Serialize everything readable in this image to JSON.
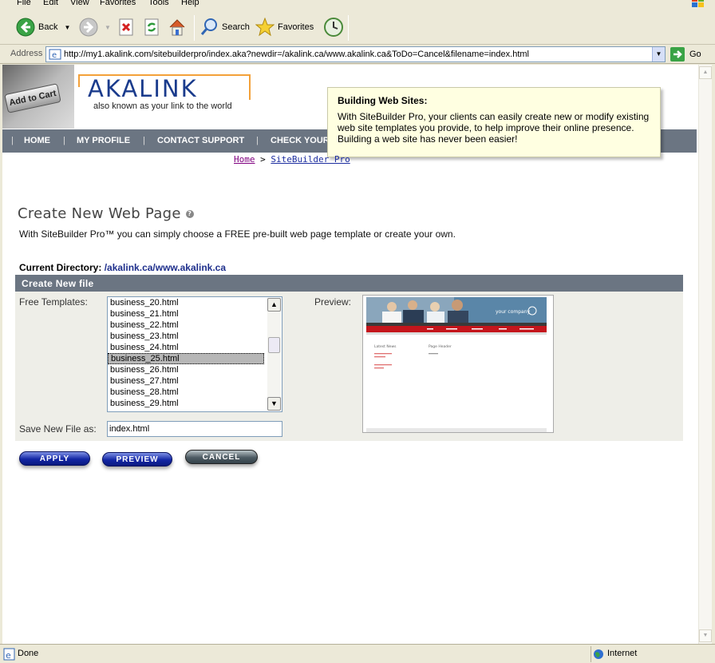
{
  "browser": {
    "menu": [
      "File",
      "Edit",
      "View",
      "Favorites",
      "Tools",
      "Help"
    ],
    "toolbar": {
      "back_label": "Back",
      "search_label": "Search",
      "favorites_label": "Favorites"
    },
    "address_label": "Address",
    "url": "http://my1.akalink.com/sitebuilderpro/index.aka?newdir=/akalink.ca/www.akalink.ca&ToDo=Cancel&filename=index.html",
    "go_label": "Go",
    "status_text": "Done",
    "zone_label": "Internet"
  },
  "header": {
    "cart_key_text": "Add to Cart",
    "logo_text": "AKALINK",
    "tagline": "also known as your link to the world",
    "nav": [
      "HOME",
      "MY PROFILE",
      "CONTACT SUPPORT",
      "CHECK YOUR"
    ]
  },
  "tooltip": {
    "title": "Building Web Sites:",
    "body": "With SiteBuilder Pro, your clients can easily create new or modify existing web site templates you provide, to help improve their online presence. Building a web site has never been easier!"
  },
  "breadcrumb": {
    "home": "Home",
    "separator": ">",
    "current": "SiteBuilder Pro"
  },
  "page": {
    "title": "Create New Web Page",
    "intro": "With SiteBuilder Pro™ you can simply choose a FREE pre-built web page template or create your own.",
    "current_dir_label": "Current Directory:",
    "current_dir": "/akalink.ca/www.akalink.ca"
  },
  "form": {
    "header": "Create New file",
    "templates_label": "Free Templates:",
    "preview_label": "Preview:",
    "templates": [
      "business_20.html",
      "business_21.html",
      "business_22.html",
      "business_23.html",
      "business_24.html",
      "business_25.html",
      "business_26.html",
      "business_27.html",
      "business_28.html",
      "business_29.html"
    ],
    "selected_template": "business_25.html",
    "save_label": "Save New File as:",
    "save_value": "index.html",
    "buttons": {
      "apply": "APPLY",
      "preview": "PREVIEW",
      "cancel": "CANCEL"
    }
  },
  "preview_thumb": {
    "brand": "your company",
    "left_heading": "Latest News",
    "right_heading": "Page Header",
    "accent": "#c4151c",
    "banner": "#5a86a8"
  }
}
